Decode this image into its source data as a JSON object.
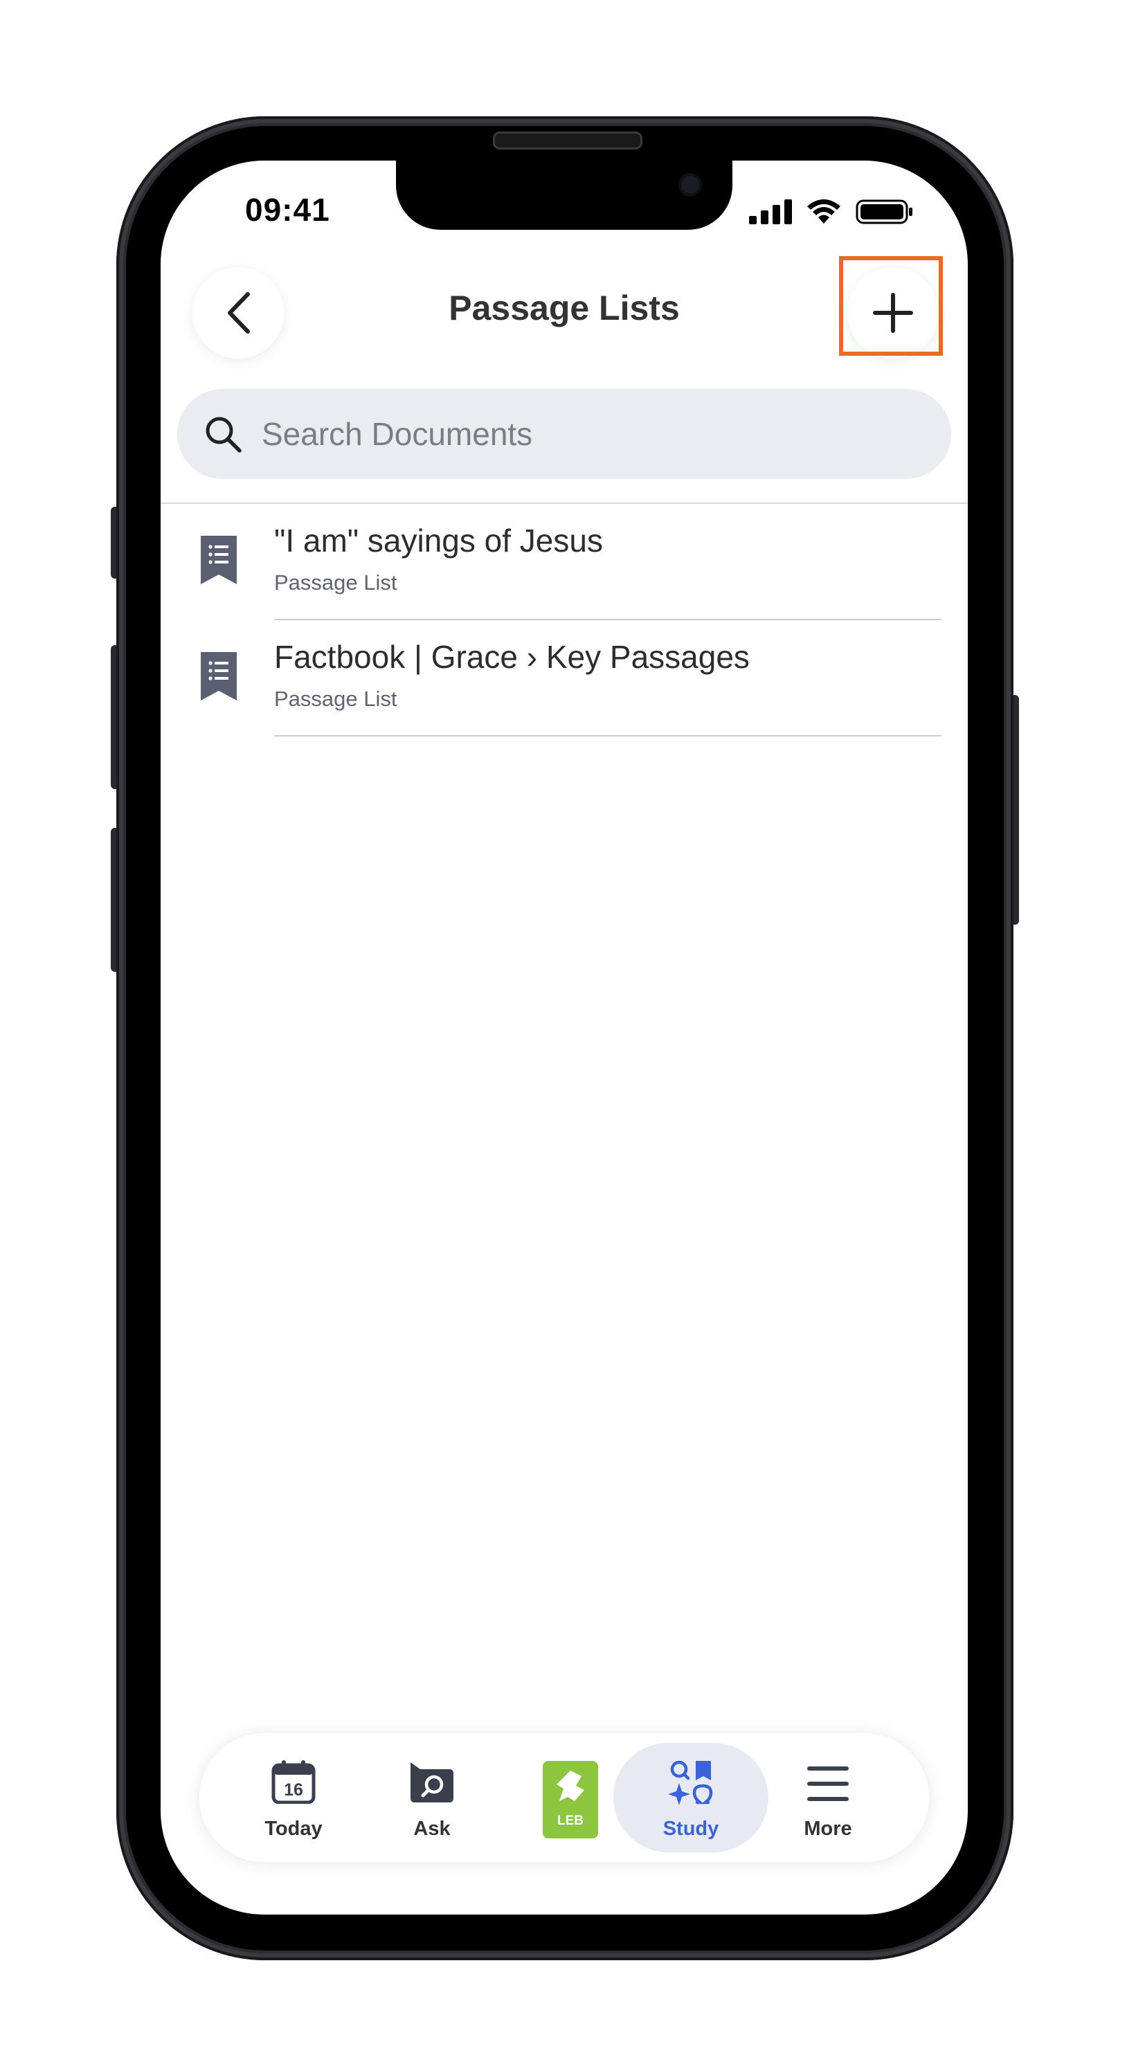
{
  "status_bar": {
    "time": "09:41"
  },
  "header": {
    "title": "Passage Lists"
  },
  "search": {
    "placeholder": "Search Documents"
  },
  "documents": [
    {
      "title": "\"I am\" sayings of Jesus",
      "subtitle": "Passage List"
    },
    {
      "title": "Factbook | Grace › Key Passages",
      "subtitle": "Passage List"
    }
  ],
  "tabbar": {
    "today_label": "Today",
    "today_date": "16",
    "ask_label": "Ask",
    "bible_badge": "LEB",
    "study_label": "Study",
    "more_label": "More"
  },
  "colors": {
    "highlight": "#ef6a1f",
    "active_tab": "#3a63d8",
    "bible_green": "#8cc63f",
    "doc_icon": "#5a5f72"
  }
}
